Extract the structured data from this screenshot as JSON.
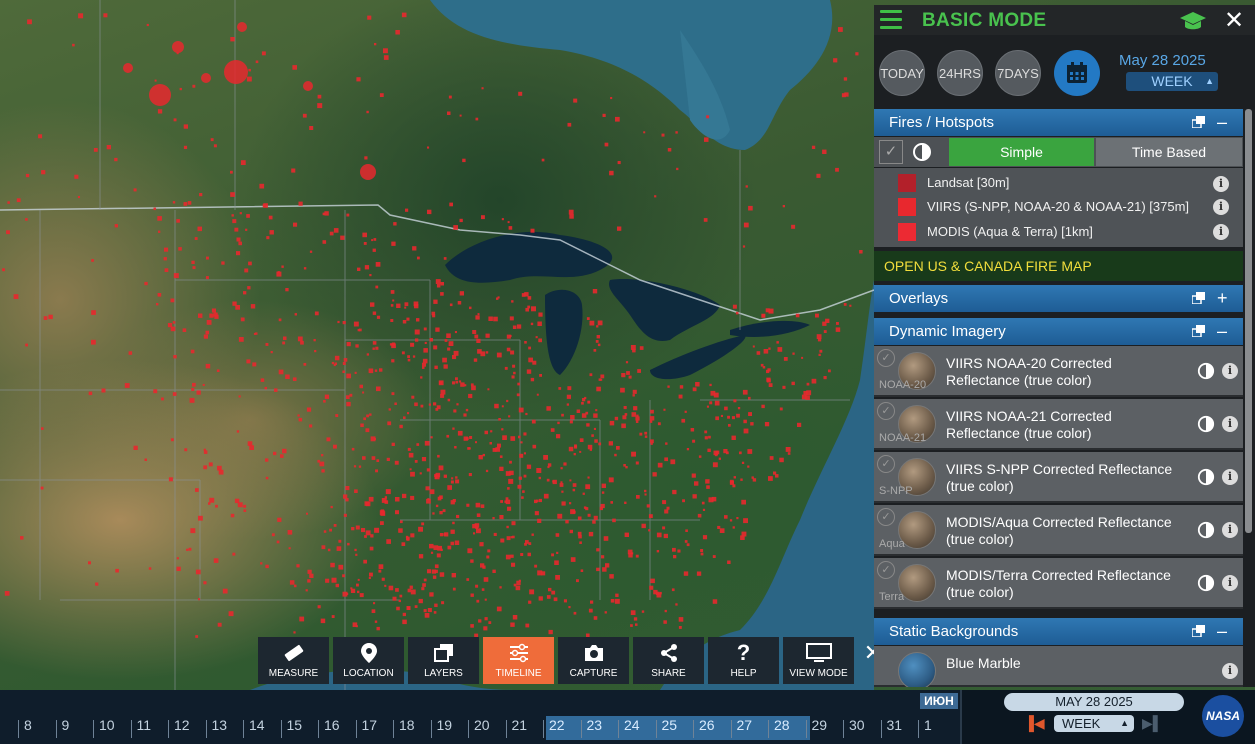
{
  "panel": {
    "mode_title": "BASIC MODE",
    "range_buttons": [
      "TODAY",
      "24HRS",
      "7DAYS"
    ],
    "date": "May 28 2025",
    "interval": "WEEK",
    "fires": {
      "title": "Fires / Hotspots",
      "toggle": "–",
      "simple_label": "Simple",
      "timebased_label": "Time Based",
      "legend": [
        {
          "label": "Landsat [30m]",
          "color": "#b3202a"
        },
        {
          "label": "VIIRS (S-NPP, NOAA-20 & NOAA-21) [375m]",
          "color": "#e8282e"
        },
        {
          "label": "MODIS (Aqua & Terra) [1km]",
          "color": "#ec2a33"
        }
      ]
    },
    "fire_map_link": "OPEN US & CANADA FIRE MAP",
    "overlays": {
      "title": "Overlays",
      "toggle": "+"
    },
    "dynamic": {
      "title": "Dynamic Imagery",
      "toggle": "–",
      "layers": [
        {
          "title": "VIIRS NOAA-20 Corrected Reflectance (true color)",
          "sub": "NOAA-20"
        },
        {
          "title": "VIIRS NOAA-21 Corrected Reflectance (true color)",
          "sub": "NOAA-21"
        },
        {
          "title": "VIIRS S-NPP Corrected Reflectance (true color)",
          "sub": "S-NPP"
        },
        {
          "title": "MODIS/Aqua Corrected Reflectance (true color)",
          "sub": "Aqua"
        },
        {
          "title": "MODIS/Terra Corrected Reflectance (true color)",
          "sub": "Terra"
        }
      ]
    },
    "static": {
      "title": "Static Backgrounds",
      "toggle": "–",
      "layers": [
        {
          "title": "Blue Marble"
        }
      ]
    }
  },
  "toolbar": {
    "items": [
      {
        "label": "MEASURE",
        "icon": "ruler-icon"
      },
      {
        "label": "LOCATION",
        "icon": "pin-icon"
      },
      {
        "label": "LAYERS",
        "icon": "layers-icon"
      },
      {
        "label": "TIMELINE",
        "icon": "sliders-icon",
        "active": true
      },
      {
        "label": "CAPTURE",
        "icon": "camera-icon"
      },
      {
        "label": "SHARE",
        "icon": "share-icon"
      },
      {
        "label": "HELP",
        "icon": "help-icon"
      },
      {
        "label": "VIEW MODE",
        "icon": "monitor-icon"
      }
    ],
    "close": "✕"
  },
  "timeline": {
    "days": [
      "8",
      "9",
      "10",
      "11",
      "12",
      "13",
      "14",
      "15",
      "16",
      "17",
      "18",
      "19",
      "20",
      "21",
      "22",
      "23",
      "24",
      "25",
      "26",
      "27",
      "28",
      "29",
      "30",
      "31",
      "1"
    ],
    "month_label": "ИЮН",
    "date": "MAY 28 2025",
    "interval": "WEEK",
    "logo_text": "NASA"
  },
  "colors": {
    "accent_green": "#49c24e",
    "header_blue": "#2f78b3",
    "fire_red": "#e8282e",
    "timeline_active": "#ef6c3a"
  }
}
